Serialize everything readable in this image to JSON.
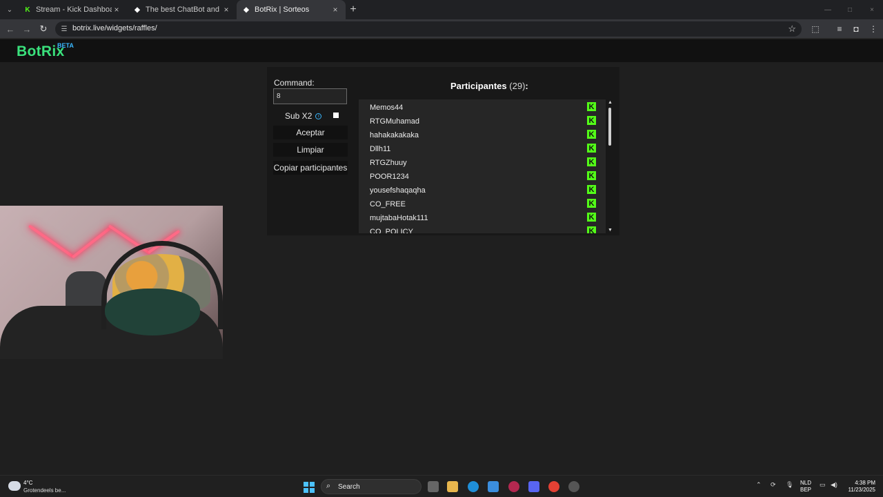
{
  "browser": {
    "tabs": [
      {
        "title": "Stream - Kick Dashboard",
        "favicon": "kick-icon"
      },
      {
        "title": "The best ChatBot and Widgets",
        "favicon": "botrix-icon"
      },
      {
        "title": "BotRix | Sorteos",
        "favicon": "botrix-icon",
        "active": true
      }
    ],
    "url": "botrix.live/widgets/raffles/"
  },
  "app": {
    "logo": "BotRix",
    "beta": "BETA",
    "brand_color": "#3ae17c"
  },
  "raffle": {
    "command_label": "Command:",
    "command_value": "8",
    "sub_label": "Sub X2",
    "accept_label": "Aceptar",
    "clear_label": "Limpiar",
    "copy_label": "Copiar participantes",
    "participants_title": "Participantes",
    "participants_count": "(29)",
    "participants_colon": ":",
    "participants": [
      "Memos44",
      "RTGMuhamad",
      "hahakakakaka",
      "Dllh11",
      "RTGZhuuy",
      "POOR1234",
      "yousefshaqaqha",
      "CO_FREE",
      "mujtabaHotak111",
      "CO_POLICY"
    ],
    "platform_icon": "kick-icon"
  },
  "taskbar": {
    "temperature": "4°C",
    "weather": "Grotendeels be...",
    "search_label": "Search",
    "language": "NLD",
    "layout": "BEP",
    "time": "4:38 PM",
    "date": "11/23/2025"
  }
}
